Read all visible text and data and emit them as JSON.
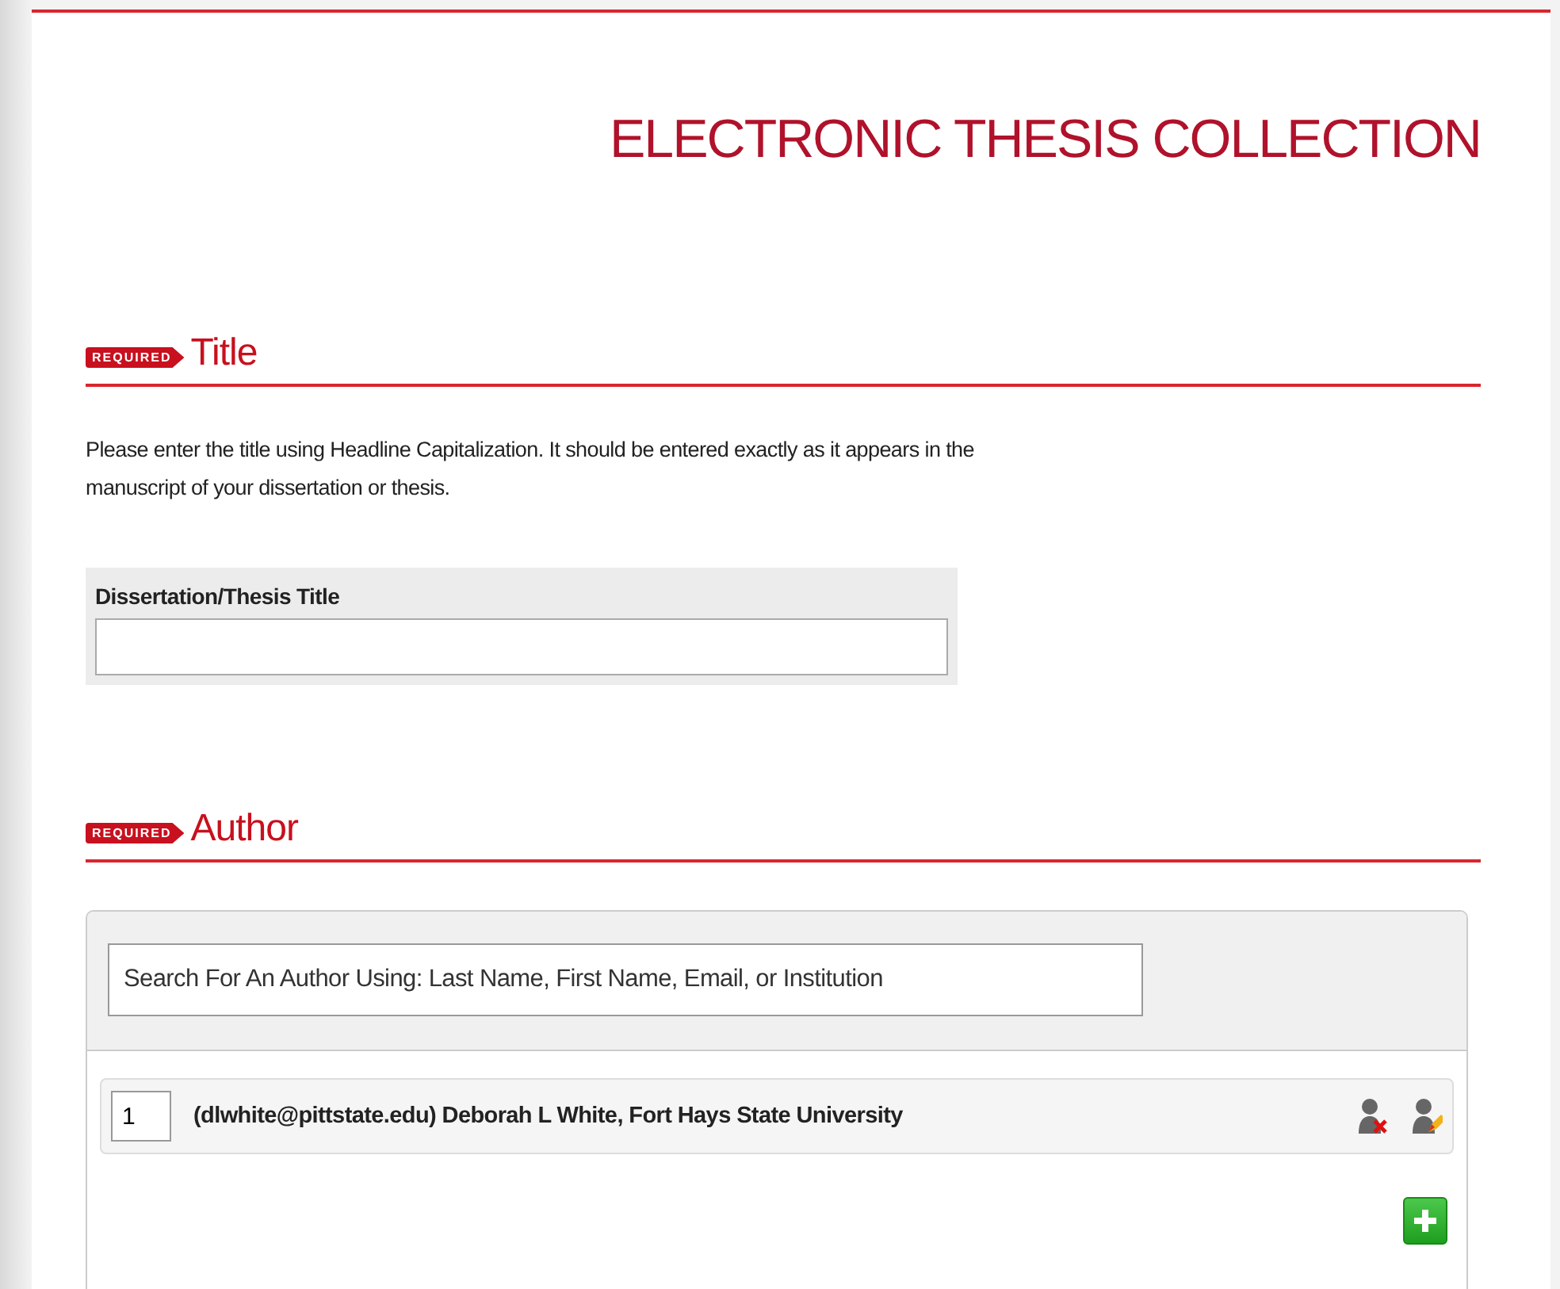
{
  "header": {
    "title": "ELECTRONIC THESIS COLLECTION"
  },
  "sections": [
    {
      "kind": "title",
      "badge": "REQUIRED",
      "heading": "Title",
      "instructions": "Please enter the title using Headline Capitalization. It should be entered exactly as it appears in the manuscript of your dissertation or thesis.",
      "field": {
        "label": "Dissertation/Thesis Title"
      }
    },
    {
      "kind": "author",
      "badge": "REQUIRED",
      "heading": "Author",
      "search": {
        "placeholder": "Search For An Author Using: Last Name, First Name, Email, or Institution"
      },
      "authors": [
        {
          "order": "1",
          "text": "(dlwhite@pittstate.edu) Deborah L White, Fort Hays State University"
        }
      ]
    }
  ]
}
